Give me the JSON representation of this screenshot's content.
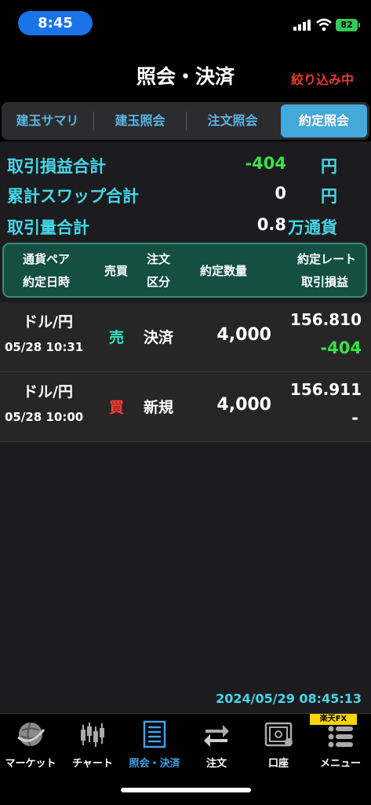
{
  "status": {
    "time": "8:45",
    "battery": "82"
  },
  "header": {
    "title": "照会・決済",
    "filter_label": "絞り込み中"
  },
  "tabs": [
    {
      "label": "建玉サマリ"
    },
    {
      "label": "建玉照会"
    },
    {
      "label": "注文照会"
    },
    {
      "label": "約定照会"
    }
  ],
  "summary": {
    "pl": {
      "label": "取引損益合計",
      "value": "-404",
      "unit": "円"
    },
    "swap": {
      "label": "累計スワップ合計",
      "value": "0",
      "unit": "円"
    },
    "volume": {
      "label": "取引量合計",
      "value": "0.8",
      "unit": "万通貨"
    }
  },
  "columns": {
    "pair": "通貨ペア",
    "date": "約定日時",
    "side": "売買",
    "type1": "注文",
    "type2": "区分",
    "qty": "約定数量",
    "rate": "約定レート",
    "pl": "取引損益"
  },
  "rows": [
    {
      "pair": "ドル/円",
      "date": "05/28 10:31",
      "side": "売",
      "type": "決済",
      "qty": "4,000",
      "rate": "156.810",
      "pl": "-404"
    },
    {
      "pair": "ドル/円",
      "date": "05/28 10:00",
      "side": "買",
      "type": "新規",
      "qty": "4,000",
      "rate": "156.911",
      "pl": "-"
    }
  ],
  "timestamp": "2024/05/29 08:45:13",
  "brand_badge": "楽天FX",
  "nav": [
    {
      "label": "マーケット",
      "icon": "globe-icon"
    },
    {
      "label": "チャート",
      "icon": "candlestick-icon"
    },
    {
      "label": "照会・決済",
      "icon": "document-list-icon"
    },
    {
      "label": "注文",
      "icon": "order-arrows-icon"
    },
    {
      "label": "口座",
      "icon": "safe-icon"
    },
    {
      "label": "メニュー",
      "icon": "menu-icon"
    }
  ],
  "colors": {
    "accent": "#43a9d9",
    "profit_negative": "#3be04a",
    "sell": "#2ee6c8",
    "buy": "#ff3b30",
    "summary_label": "#46d6e8",
    "filter": "#e53935"
  }
}
